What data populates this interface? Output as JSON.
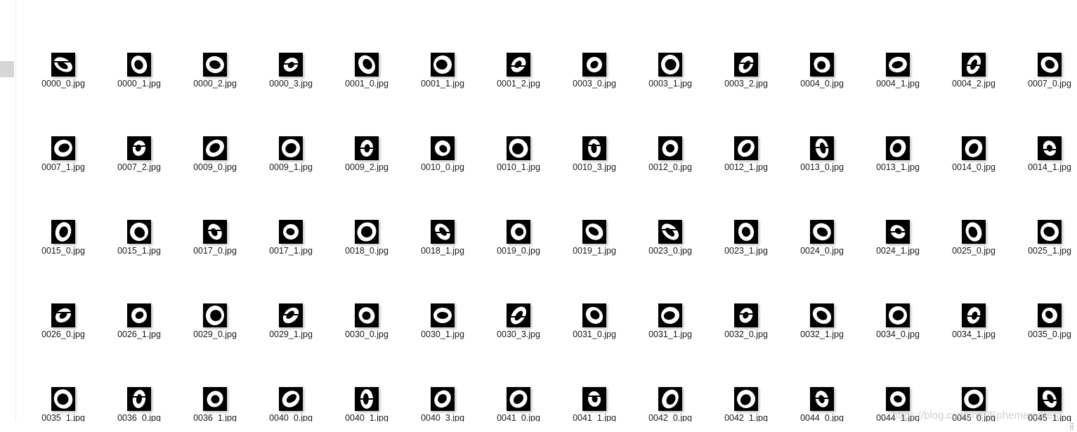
{
  "files": [
    {
      "name": "0000_0.jpg"
    },
    {
      "name": "0000_1.jpg"
    },
    {
      "name": "0000_2.jpg"
    },
    {
      "name": "0000_3.jpg"
    },
    {
      "name": "0001_0.jpg"
    },
    {
      "name": "0001_1.jpg"
    },
    {
      "name": "0001_2.jpg"
    },
    {
      "name": "0003_0.jpg"
    },
    {
      "name": "0003_1.jpg"
    },
    {
      "name": "0003_2.jpg"
    },
    {
      "name": "0004_0.jpg"
    },
    {
      "name": "0004_1.jpg"
    },
    {
      "name": "0004_2.jpg"
    },
    {
      "name": "0007_0.jpg"
    },
    {
      "name": "0007_1.jpg"
    },
    {
      "name": "0007_2.jpg"
    },
    {
      "name": "0009_0.jpg"
    },
    {
      "name": "0009_1.jpg"
    },
    {
      "name": "0009_2.jpg"
    },
    {
      "name": "0010_0.jpg"
    },
    {
      "name": "0010_1.jpg"
    },
    {
      "name": "0010_3.jpg"
    },
    {
      "name": "0012_0.jpg"
    },
    {
      "name": "0012_1.jpg"
    },
    {
      "name": "0013_0.jpg"
    },
    {
      "name": "0013_1.jpg"
    },
    {
      "name": "0014_0.jpg"
    },
    {
      "name": "0014_1.jpg"
    },
    {
      "name": "0015_0.jpg"
    },
    {
      "name": "0015_1.jpg"
    },
    {
      "name": "0017_0.jpg"
    },
    {
      "name": "0017_1.jpg"
    },
    {
      "name": "0018_0.jpg"
    },
    {
      "name": "0018_1.jpg"
    },
    {
      "name": "0019_0.jpg"
    },
    {
      "name": "0019_1.jpg"
    },
    {
      "name": "0023_0.jpg"
    },
    {
      "name": "0023_1.jpg"
    },
    {
      "name": "0024_0.jpg"
    },
    {
      "name": "0024_1.jpg"
    },
    {
      "name": "0025_0.jpg"
    },
    {
      "name": "0025_1.jpg"
    },
    {
      "name": "0026_0.jpg"
    },
    {
      "name": "0026_1.jpg"
    },
    {
      "name": "0029_0.jpg"
    },
    {
      "name": "0029_1.jpg"
    },
    {
      "name": "0030_0.jpg"
    },
    {
      "name": "0030_1.jpg"
    },
    {
      "name": "0030_3.jpg"
    },
    {
      "name": "0031_0.jpg"
    },
    {
      "name": "0031_1.jpg"
    },
    {
      "name": "0032_0.jpg"
    },
    {
      "name": "0032_1.jpg"
    },
    {
      "name": "0034_0.jpg"
    },
    {
      "name": "0034_1.jpg"
    },
    {
      "name": "0035_0.jpg"
    },
    {
      "name": "0035_1.jpg"
    },
    {
      "name": "0036_0.jpg"
    },
    {
      "name": "0036_1.jpg"
    },
    {
      "name": "0040_0.jpg"
    },
    {
      "name": "0040_1.jpg"
    },
    {
      "name": "0040_3.jpg"
    },
    {
      "name": "0041_0.jpg"
    },
    {
      "name": "0041_1.jpg"
    },
    {
      "name": "0042_0.jpg"
    },
    {
      "name": "0042_1.jpg"
    },
    {
      "name": "0044_0.jpg"
    },
    {
      "name": "0044_1.jpg"
    },
    {
      "name": "0045_0.jpg"
    },
    {
      "name": "0045_1.jpg"
    }
  ],
  "watermark": "https://blog.csdn.net/Ephemeroptera",
  "colors": {
    "thumb_bg": "#000000",
    "thumb_fg": "#ffffff",
    "text": "#1a1a1a"
  },
  "icons": {
    "thumbnail": "digit-zero-thumbnail-icon",
    "resize": "resize-grip-icon"
  }
}
